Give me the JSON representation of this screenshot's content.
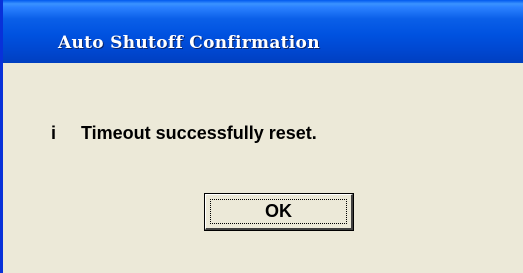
{
  "window": {
    "title": "Auto Shutoff Confirmation"
  },
  "dialog": {
    "icon": "info-icon",
    "icon_glyph": "i",
    "message": "Timeout successfully reset.",
    "ok_label": "OK"
  },
  "colors": {
    "titlebar": "#0054e3",
    "dialog_background": "#ece9d8",
    "title_text": "#ffffff"
  }
}
